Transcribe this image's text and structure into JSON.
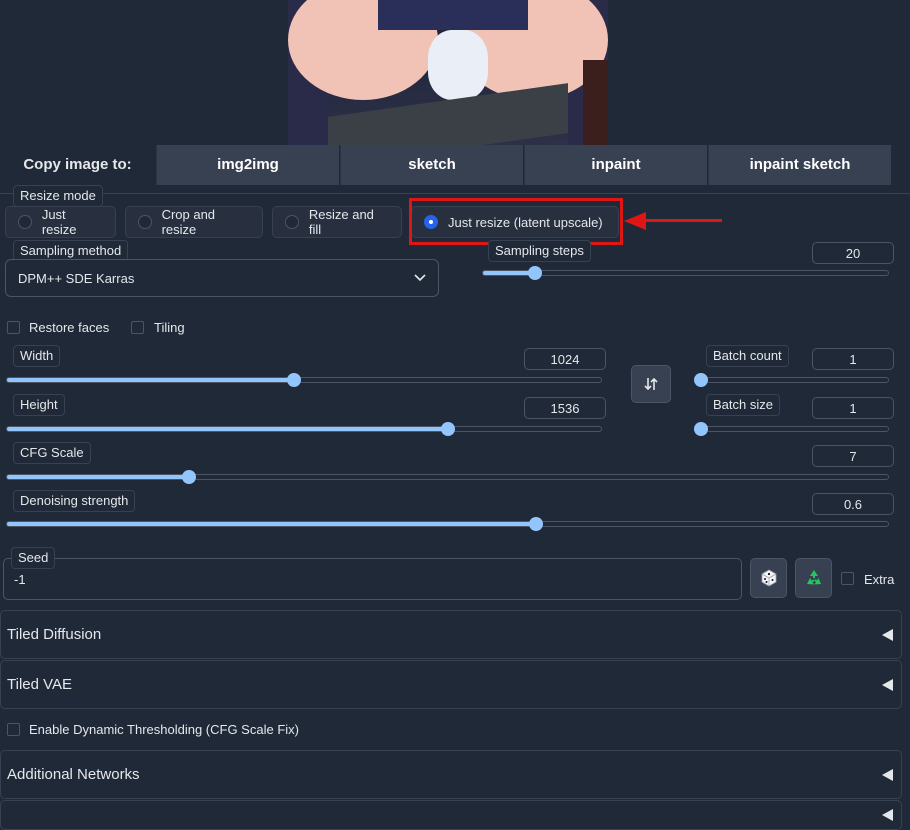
{
  "copy_image": {
    "label": "Copy image to:",
    "buttons": [
      "img2img",
      "sketch",
      "inpaint",
      "inpaint sketch"
    ]
  },
  "resize_mode": {
    "label": "Resize mode",
    "options": [
      "Just resize",
      "Crop and resize",
      "Resize and fill",
      "Just resize (latent upscale)"
    ],
    "selected": "Just resize (latent upscale)"
  },
  "sampling_method": {
    "label": "Sampling method",
    "value": "DPM++ SDE Karras"
  },
  "sampling_steps": {
    "label": "Sampling steps",
    "value": "20",
    "min": 1,
    "max": 150,
    "current": 20
  },
  "checkboxes": {
    "restore_faces": "Restore faces",
    "tiling": "Tiling"
  },
  "width": {
    "label": "Width",
    "value": "1024",
    "min": 64,
    "max": 2048,
    "current": 1024
  },
  "height": {
    "label": "Height",
    "value": "1536",
    "min": 64,
    "max": 2048,
    "current": 1536
  },
  "batch_count": {
    "label": "Batch count",
    "value": "1",
    "min": 1,
    "max": 100,
    "current": 1
  },
  "batch_size": {
    "label": "Batch size",
    "value": "1",
    "min": 1,
    "max": 8,
    "current": 1
  },
  "cfg_scale": {
    "label": "CFG Scale",
    "value": "7",
    "min": 1,
    "max": 30,
    "current": 7
  },
  "denoising": {
    "label": "Denoising strength",
    "value": "0.6",
    "min": 0,
    "max": 1,
    "current": 0.6
  },
  "seed": {
    "label": "Seed",
    "value": "-1",
    "extra_label": "Extra"
  },
  "sections": {
    "tiled_diffusion": "Tiled Diffusion",
    "tiled_vae": "Tiled VAE",
    "dynamic_thresholding": "Enable Dynamic Thresholding (CFG Scale Fix)",
    "additional_networks": "Additional Networks"
  },
  "icons": {
    "swap": "swap-arrows-icon",
    "dice": "dice-icon",
    "recycle": "recycle-icon",
    "dropdown": "chevron-down-icon",
    "collapse": "triangle-left-icon"
  },
  "colors": {
    "background": "#1f2937",
    "accent_slider": "#93c5fd",
    "highlight": "#e01515",
    "selected_radio": "#2563eb"
  }
}
